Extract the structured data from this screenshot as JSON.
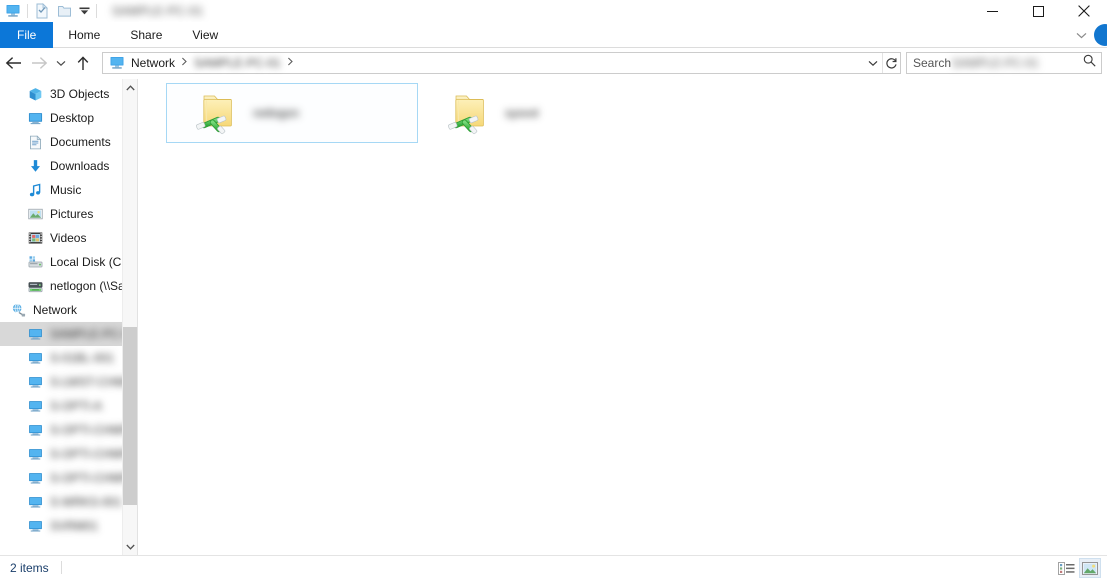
{
  "window": {
    "title_blurred": "SAMPLE-PC-01",
    "quick_access": [
      {
        "name": "computer-icon",
        "label": "This PC"
      },
      {
        "name": "properties-icon",
        "label": "Properties"
      },
      {
        "name": "new-folder-icon",
        "label": "New folder"
      },
      {
        "name": "customize-qat-chevron-icon",
        "label": "Customize Quick Access Toolbar"
      }
    ],
    "controls": {
      "minimize": "minimize-icon",
      "maximize": "maximize-icon",
      "close": "close-icon"
    }
  },
  "ribbon": {
    "tabs": [
      {
        "label": "File",
        "active_blue": true
      },
      {
        "label": "Home",
        "active_blue": false
      },
      {
        "label": "Share",
        "active_blue": false
      },
      {
        "label": "View",
        "active_blue": false
      }
    ],
    "collapse_label": "Expand the Ribbon",
    "help_label": "Help"
  },
  "navigation": {
    "back_label": "Back",
    "forward_label": "Forward",
    "recent_label": "Recent locations",
    "up_label": "Up",
    "breadcrumbs": [
      {
        "label": "Network",
        "blurred": false
      },
      {
        "label": "SAMPLE-PC-01",
        "blurred": true
      }
    ],
    "address_dropdown_label": "Previous locations",
    "refresh_label": "Refresh"
  },
  "search": {
    "label": "Search",
    "value_blurred": "SAMPLE-PC-01",
    "icon": "search-icon"
  },
  "sidebar": {
    "items": [
      {
        "label": "3D Objects",
        "icon": "3d-objects-icon",
        "level": 1,
        "selected": false,
        "blurred": false
      },
      {
        "label": "Desktop",
        "icon": "desktop-icon",
        "level": 1,
        "selected": false,
        "blurred": false
      },
      {
        "label": "Documents",
        "icon": "documents-icon",
        "level": 1,
        "selected": false,
        "blurred": false
      },
      {
        "label": "Downloads",
        "icon": "downloads-icon",
        "level": 1,
        "selected": false,
        "blurred": false
      },
      {
        "label": "Music",
        "icon": "music-icon",
        "level": 1,
        "selected": false,
        "blurred": false
      },
      {
        "label": "Pictures",
        "icon": "pictures-icon",
        "level": 1,
        "selected": false,
        "blurred": false
      },
      {
        "label": "Videos",
        "icon": "videos-icon",
        "level": 1,
        "selected": false,
        "blurred": false
      },
      {
        "label": "Local Disk (C:)",
        "icon": "local-disk-icon",
        "level": 1,
        "selected": false,
        "blurred": false
      },
      {
        "label": "netlogon (\\\\Sam",
        "icon": "network-drive-icon",
        "level": 1,
        "selected": false,
        "blurred": false
      },
      {
        "label": "Network",
        "icon": "network-icon",
        "level": 0,
        "selected": false,
        "blurred": false
      },
      {
        "label": "SAMPLE-PC-01",
        "icon": "computer-icon",
        "level": 1,
        "selected": true,
        "blurred": true
      },
      {
        "label": "S-01BL-001",
        "icon": "computer-icon",
        "level": 1,
        "selected": false,
        "blurred": true
      },
      {
        "label": "S-LWST-CHMP-A",
        "icon": "computer-icon",
        "level": 1,
        "selected": false,
        "blurred": true
      },
      {
        "label": "S-OPTI-A",
        "icon": "computer-icon",
        "level": 1,
        "selected": false,
        "blurred": true
      },
      {
        "label": "S-OPTI-CHMP-A",
        "icon": "computer-icon",
        "level": 1,
        "selected": false,
        "blurred": true
      },
      {
        "label": "S-OPTI-CHMP-B",
        "icon": "computer-icon",
        "level": 1,
        "selected": false,
        "blurred": true
      },
      {
        "label": "S-OPTI-CHMP-C",
        "icon": "computer-icon",
        "level": 1,
        "selected": false,
        "blurred": true
      },
      {
        "label": "S-WRKS-001",
        "icon": "computer-icon",
        "level": 1,
        "selected": false,
        "blurred": true
      },
      {
        "label": "SVRM01",
        "icon": "computer-icon",
        "level": 1,
        "selected": false,
        "blurred": true
      }
    ],
    "scrollbar": {
      "up_label": "Scroll up",
      "down_label": "Scroll down"
    }
  },
  "content": {
    "items": [
      {
        "label": "netlogon",
        "icon": "shared-folder-icon",
        "hover": true,
        "label_width": 56
      },
      {
        "label": "sysvol",
        "icon": "shared-folder-icon",
        "hover": false,
        "label_width": 36
      }
    ]
  },
  "statusbar": {
    "item_count": "2 items",
    "views": [
      {
        "name": "details-view-button",
        "label": "Details view",
        "active": false
      },
      {
        "name": "large-icons-view-button",
        "label": "Large icons view",
        "active": true
      }
    ]
  }
}
